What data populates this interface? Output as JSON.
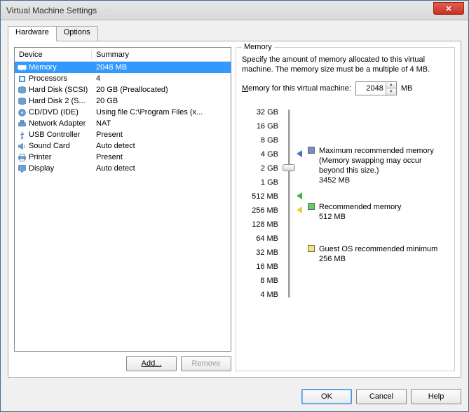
{
  "window": {
    "title": "Virtual Machine Settings"
  },
  "tabs": {
    "hardware": "Hardware",
    "options": "Options"
  },
  "table": {
    "head_device": "Device",
    "head_summary": "Summary",
    "rows": [
      {
        "icon": "memory",
        "name": "Memory",
        "summary": "2048 MB",
        "selected": true
      },
      {
        "icon": "cpu",
        "name": "Processors",
        "summary": "4"
      },
      {
        "icon": "disk",
        "name": "Hard Disk (SCSI)",
        "summary": "20 GB (Preallocated)"
      },
      {
        "icon": "disk",
        "name": "Hard Disk 2 (S...",
        "summary": "20 GB"
      },
      {
        "icon": "cd",
        "name": "CD/DVD (IDE)",
        "summary": "Using file C:\\Program Files (x..."
      },
      {
        "icon": "net",
        "name": "Network Adapter",
        "summary": "NAT"
      },
      {
        "icon": "usb",
        "name": "USB Controller",
        "summary": "Present"
      },
      {
        "icon": "sound",
        "name": "Sound Card",
        "summary": "Auto detect"
      },
      {
        "icon": "printer",
        "name": "Printer",
        "summary": "Present"
      },
      {
        "icon": "display",
        "name": "Display",
        "summary": "Auto detect"
      }
    ]
  },
  "buttons": {
    "add": "Add...",
    "remove": "Remove",
    "ok": "OK",
    "cancel": "Cancel",
    "help": "Help"
  },
  "memory": {
    "group_label": "Memory",
    "desc": "Specify the amount of memory allocated to this virtual machine. The memory size must be a multiple of 4 MB.",
    "input_label": "Memory for this virtual machine:",
    "value": "2048",
    "unit": "MB",
    "ticks": [
      "32 GB",
      "16 GB",
      "8 GB",
      "4 GB",
      "2 GB",
      "1 GB",
      "512 MB",
      "256 MB",
      "128 MB",
      "64 MB",
      "32 MB",
      "16 MB",
      "8 MB",
      "4 MB"
    ],
    "legend": {
      "max": {
        "title": "Maximum recommended memory",
        "note": "(Memory swapping may occur beyond this size.)",
        "value": "3452 MB"
      },
      "rec": {
        "title": "Recommended memory",
        "value": "512 MB"
      },
      "min": {
        "title": "Guest OS recommended minimum",
        "value": "256 MB"
      }
    }
  }
}
